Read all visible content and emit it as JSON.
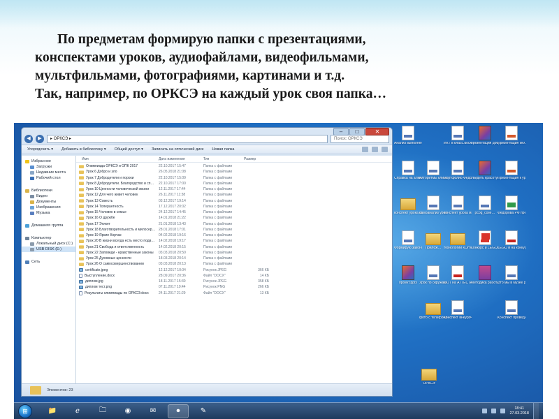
{
  "slide": {
    "lines": [
      "По предметам формирую папки с презентациями,",
      "конспектами уроков, аудиофайлами, видеофильмами,",
      "мультфильмами, фотографиями, картинами и т.д.",
      "Так, например, по ОРКСЭ на каждый урок своя папка…"
    ]
  },
  "explorer": {
    "path": "▸ ОРКСЭ ▸",
    "search_placeholder": "Поиск: ОРКСЭ",
    "toolbar": [
      "Упорядочить ▾",
      "Добавить в библиотеку ▾",
      "Общий доступ ▾",
      "Записать на оптический диск",
      "Новая папка"
    ],
    "nav": {
      "favorites": {
        "title": "Избранное",
        "items": [
          "Загрузки",
          "Недавние места",
          "Рабочий стол"
        ]
      },
      "libraries": {
        "title": "Библиотеки",
        "items": [
          "Видео",
          "Документы",
          "Изображения",
          "Музыка"
        ]
      },
      "homegroup": "Домашняя группа",
      "computer": {
        "title": "Компьютер",
        "items": [
          "Локальный диск (C:)",
          "USB DISK (E:)"
        ]
      },
      "network": "Сеть"
    },
    "columns": {
      "name": "Имя",
      "date": "Дата изменения",
      "type": "Тип",
      "size": "Размер"
    },
    "files": [
      {
        "name": "Олимпиада ОРКСЭ и ОПК 2017",
        "date": "22.10.2017 15:47",
        "type": "Папка с файлами",
        "size": "",
        "kind": "folder"
      },
      {
        "name": "Урок 6 Добро и зло",
        "date": "26.05.2018 21:08",
        "type": "Папка с файлами",
        "size": "",
        "kind": "folder"
      },
      {
        "name": "Урок 7 Добродетели и пороки",
        "date": "22.10.2017 15:09",
        "type": "Папка с файлами",
        "size": "",
        "kind": "folder"
      },
      {
        "name": "Урок 8 Добродетели. Благородство и сп…",
        "date": "22.10.2017 17:00",
        "type": "Папка с файлами",
        "size": "",
        "kind": "folder"
      },
      {
        "name": "Урок 10 Ценности человеческой жизни",
        "date": "12.11.2017 17:44",
        "type": "Папка с файлами",
        "size": "",
        "kind": "folder"
      },
      {
        "name": "Урок 12 Для чего живет человек",
        "date": "26.11.2017 11:38",
        "type": "Папка с файлами",
        "size": "",
        "kind": "folder"
      },
      {
        "name": "Урок 13 Совесть",
        "date": "03.12.2017 19:14",
        "type": "Папка с файлами",
        "size": "",
        "kind": "folder"
      },
      {
        "name": "Урок 14 Толерантность",
        "date": "17.12.2017 20:02",
        "type": "Папка с файлами",
        "size": "",
        "kind": "folder"
      },
      {
        "name": "Урок 15 Человек в семье",
        "date": "24.12.2017 14:45",
        "type": "Папка с файлами",
        "size": "",
        "kind": "folder"
      },
      {
        "name": "Урок 16 О дружбе",
        "date": "14.01.2018 21:22",
        "type": "Папка с файлами",
        "size": "",
        "kind": "folder"
      },
      {
        "name": "Урок 17 Этикет",
        "date": "21.01.2018 13:43",
        "type": "Папка с файлами",
        "size": "",
        "kind": "folder"
      },
      {
        "name": "Урок 18 Благотворительность и милосер…",
        "date": "28.01.2018 17:01",
        "type": "Папка с файлами",
        "size": "",
        "kind": "folder"
      },
      {
        "name": "Урок 19 Яркие Корчак",
        "date": "04.02.2018 19:16",
        "type": "Папка с файлами",
        "size": "",
        "kind": "folder"
      },
      {
        "name": "Урок 20 В жизни всегда есть место подв…",
        "date": "14.02.2018 19:17",
        "type": "Папка с файлами",
        "size": "",
        "kind": "folder"
      },
      {
        "name": "Урок 21 Свобода и ответственность",
        "date": "14.02.2018 20:15",
        "type": "Папка с файлами",
        "size": "",
        "kind": "folder"
      },
      {
        "name": "Урок 22 Заповеди - нравственные законы",
        "date": "03.03.2018 20:50",
        "type": "Папка с файлами",
        "size": "",
        "kind": "folder"
      },
      {
        "name": "Урок 25 Духовные ценности",
        "date": "18.03.2018 20:14",
        "type": "Папка с файлами",
        "size": "",
        "kind": "folder"
      },
      {
        "name": "Урок 26 О самосовершенствовании",
        "date": "03.03.2018 20:13",
        "type": "Папка с файлами",
        "size": "",
        "kind": "folder"
      },
      {
        "name": "certificate.jpeg",
        "date": "12.12.2017 10:04",
        "type": "Рисунок JPEG",
        "size": "366 КБ",
        "kind": "img"
      },
      {
        "name": "Выступление.docx",
        "date": "28.09.2017 20:36",
        "type": "Файл \"DOCX\"",
        "size": "14 КБ",
        "kind": "doc"
      },
      {
        "name": "диплом.jpg",
        "date": "18.11.2017 15:30",
        "type": "Рисунок JPEG",
        "size": "358 КБ",
        "kind": "img"
      },
      {
        "name": "диплом тест.png",
        "date": "07.11.2017 19:44",
        "type": "Рисунок PNG",
        "size": "266 КБ",
        "kind": "img"
      },
      {
        "name": "Результаты олимпиады по ОРКСЭ.docx",
        "date": "24.11.2017 21:29",
        "type": "Файл \"DOCX\"",
        "size": "13 КБ",
        "kind": "doc"
      }
    ],
    "status": "Элементов: 23"
  },
  "desktop_icons": [
    {
      "label": "Анализ выполнен…",
      "kind": "doc"
    },
    {
      "label": "ИКТ в класс.docx",
      "kind": "doc"
    },
    {
      "label": "презентация добро и зл…",
      "kind": "pic"
    },
    {
      "label": "Презентация ИКОНКС и…",
      "kind": "ppt"
    },
    {
      "label": "Справка на алмаз.docx",
      "kind": "doc"
    },
    {
      "label": "Алгоритмы климат.docx",
      "kind": "doc"
    },
    {
      "label": "Портфолио Федорова …",
      "kind": "doc"
    },
    {
      "label": "Увидеть красоту в …",
      "kind": "pic"
    },
    {
      "label": "Презентация к уроку Свя…",
      "kind": "ppt"
    },
    {
      "label": "конспект урока истории",
      "kind": "folder"
    },
    {
      "label": "самоанализ уроков по…",
      "kind": "doc"
    },
    {
      "label": "конспект урока матем",
      "kind": "doc"
    },
    {
      "label": "pcog_colle…",
      "kind": "doc"
    },
    {
      "label": "Федорова РФ презентаци…",
      "kind": "green"
    },
    {
      "label": "Формирую закономер…",
      "kind": "doc"
    },
    {
      "label": "Прилож…",
      "kind": "folder"
    },
    {
      "label": "технологии КОНСПЕКТ…",
      "kind": "folder"
    },
    {
      "label": "Конкурс и LEGO на ко…",
      "kind": "redbox"
    },
    {
      "label": "LEGO и на конкурс…",
      "kind": "pdf"
    },
    {
      "label": "проект.pptx",
      "kind": "pic"
    },
    {
      "label": "Урок по окружаю…",
      "kind": "doc"
    },
    {
      "label": "ФОТ на АТТЕСТАЦ…",
      "kind": "pdf"
    },
    {
      "label": "Методика работы над…",
      "kind": "arch"
    },
    {
      "label": "Это мы в музее ро…",
      "kind": "doc"
    },
    {
      "label": "фото с телефона",
      "kind": "folder"
    },
    {
      "label": "Конспект внеурочн…",
      "kind": "doc"
    },
    {
      "label": "Конспект проведение…",
      "kind": "doc"
    },
    {
      "label": "ОРКСЭ",
      "kind": "folder"
    }
  ],
  "taskbar": {
    "start": "⊞",
    "apps": [
      "📁",
      "ℯ",
      "🗀",
      "◉",
      "✉",
      "⏺",
      "✎"
    ],
    "clock_time": "18:41",
    "clock_date": "27.03.2018"
  },
  "colors": {
    "desktop": "#1f6ec2",
    "folder": "#e8c25a",
    "window_frame": "#d9e6f4"
  }
}
